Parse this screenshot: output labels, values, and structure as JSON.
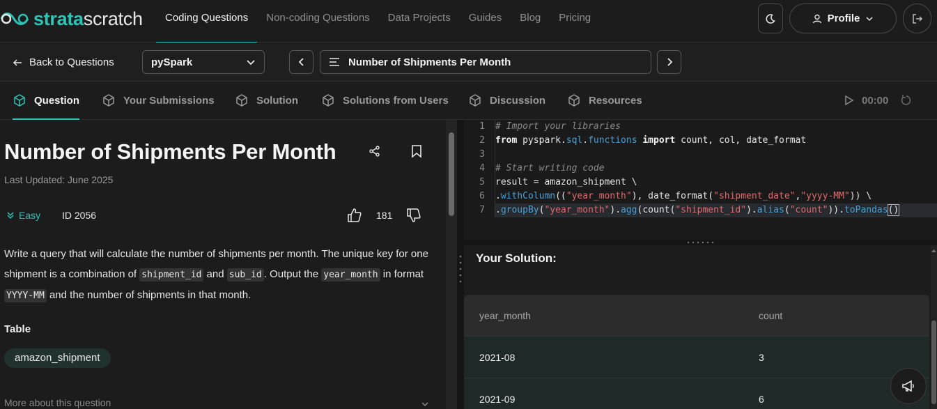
{
  "brand": {
    "part1": "strata",
    "part2": "scratch"
  },
  "nav": {
    "links": [
      "Coding Questions",
      "Non-coding Questions",
      "Data Projects",
      "Guides",
      "Blog",
      "Pricing"
    ],
    "profile_label": "Profile"
  },
  "toolbar": {
    "back_label": "Back to Questions",
    "language": "pySpark",
    "question_title": "Number of Shipments Per Month"
  },
  "tabs": [
    "Question",
    "Your Submissions",
    "Solution",
    "Solutions from Users",
    "Discussion",
    "Resources"
  ],
  "timer": "00:00",
  "question": {
    "title": "Number of Shipments Per Month",
    "last_updated": "Last Updated: June 2025",
    "difficulty": "Easy",
    "id": "ID 2056",
    "likes": "181",
    "desc": {
      "p1": "Write a query that will calculate the number of shipments per month. The unique key for one shipment is a combination of ",
      "code1": "shipment_id",
      "p2": " and ",
      "code2": "sub_id",
      "p3": ". Output the ",
      "code3": "year_month",
      "p4": " in format ",
      "code4": "YYYY-MM",
      "p5": " and the number of shipments in that month."
    },
    "table_label": "Table",
    "table_name": "amazon_shipment",
    "more_label": "More about this question"
  },
  "editor": {
    "line_numbers": [
      "1",
      "2",
      "3",
      "4",
      "5",
      "6",
      "7"
    ],
    "l1": "# Import your libraries",
    "l2_kw1": "from",
    "l2_a": " pyspark.",
    "l2_mod1": "sql",
    "l2_dot": ".",
    "l2_mod2": "functions",
    "l2_kw2": " import",
    "l2_b": " count, col, date_format",
    "l4": "# Start writing code",
    "l5": "result = amazon_shipment \\",
    "l6_a": ".",
    "l6_fn": "withColumn",
    "l6_b": "((",
    "l6_s1": "\"year_month\"",
    "l6_c": "), date_format(",
    "l6_s2": "\"shipment_date\"",
    "l6_d": ",",
    "l6_s3": "\"yyyy-MM\"",
    "l6_e": ")) \\",
    "l7_a": ".",
    "l7_fn1": "groupBy",
    "l7_b": "(",
    "l7_s1": "\"year_month\"",
    "l7_c": ").",
    "l7_fn2": "agg",
    "l7_d": "(count(",
    "l7_s2": "\"shipment_id\"",
    "l7_e": ").",
    "l7_fn3": "alias",
    "l7_f": "(",
    "l7_s3": "\"count\"",
    "l7_g": ")).",
    "l7_fn4": "toPandas",
    "l7_h": "()"
  },
  "results": {
    "title": "Your Solution:",
    "columns": [
      "year_month",
      "count"
    ],
    "rows": [
      [
        "2021-08",
        "3"
      ],
      [
        "2021-09",
        "6"
      ]
    ]
  },
  "colors": {
    "accent": "#2ec4b6",
    "string": "#e06a6a",
    "module": "#4a9fd6"
  }
}
